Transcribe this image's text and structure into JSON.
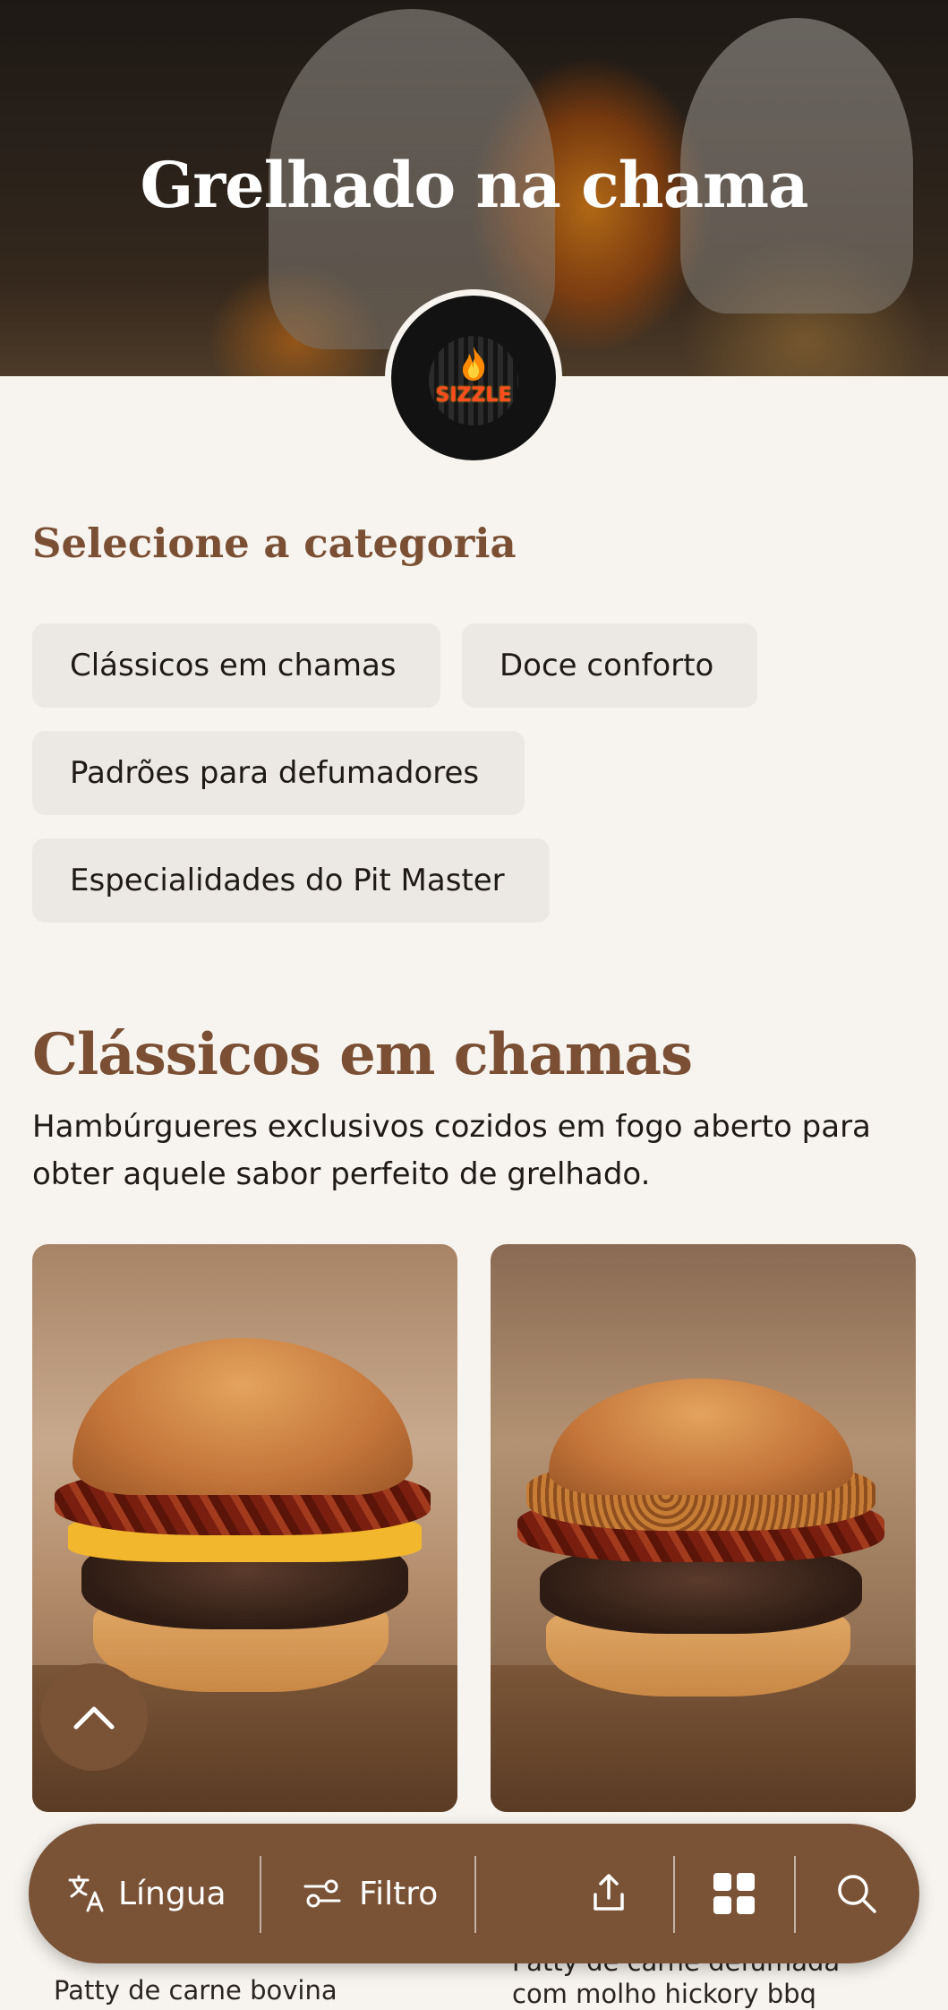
{
  "hero": {
    "title": "Grelhado na chama",
    "logo_text": "SIZZLE"
  },
  "category_section": {
    "heading": "Selecione a categoria",
    "chips": [
      "Clássicos em chamas",
      "Doce conforto",
      "Padrões para defumadores",
      "Especialidades do Pit Master"
    ]
  },
  "category": {
    "title": "Clássicos em chamas",
    "description": "Hambúrgueres exclusivos cozidos em fogo aberto para obter aquele sabor perfeito de grelhado."
  },
  "products": [
    {
      "desc_partial": "Patty de carne bovina"
    },
    {
      "desc_partial_1": "Patty de carne defumada",
      "desc_partial_2": "com molho hickory bbq"
    }
  ],
  "bottom_nav": {
    "language_label": "Língua",
    "filter_label": "Filtro",
    "icons": [
      "translate-icon",
      "filter-icon",
      "share-icon",
      "grid-icon",
      "search-icon"
    ]
  },
  "colors": {
    "accent_brown": "#7a5236",
    "heading_brown": "#7a4f34",
    "background": "#f7f4ef",
    "chip_bg": "#ece9e4"
  }
}
